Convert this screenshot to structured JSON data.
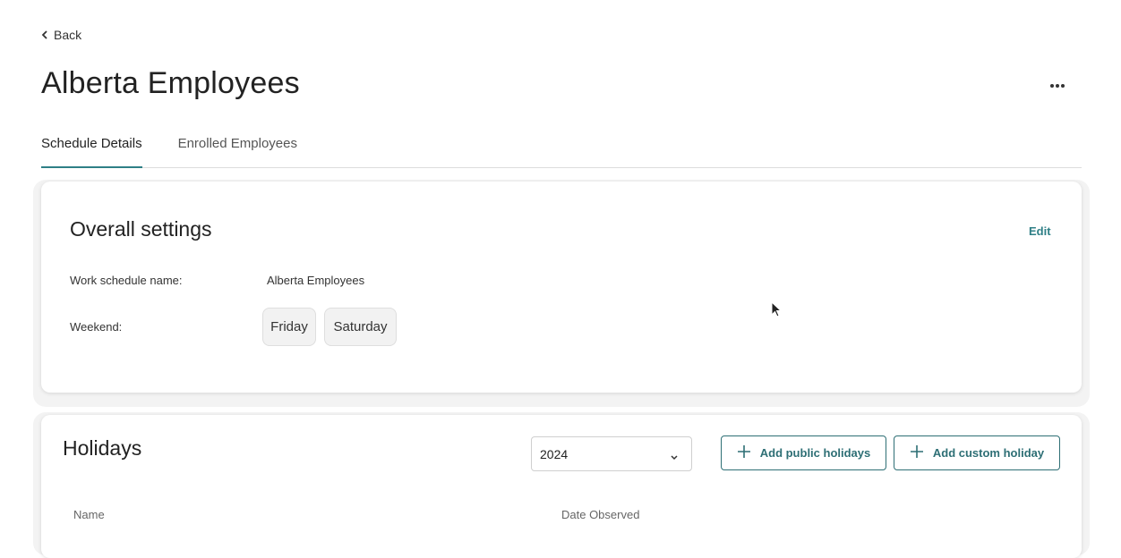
{
  "nav": {
    "back_label": "Back"
  },
  "page": {
    "title": "Alberta Employees"
  },
  "tabs": [
    {
      "label": "Schedule Details",
      "active": true
    },
    {
      "label": "Enrolled Employees",
      "active": false
    }
  ],
  "overall_settings": {
    "title": "Overall settings",
    "edit_label": "Edit",
    "work_schedule_name_label": "Work schedule name:",
    "work_schedule_name_value": "Alberta Employees",
    "weekend_label": "Weekend:",
    "weekend_days": [
      "Friday",
      "Saturday"
    ]
  },
  "holidays": {
    "title": "Holidays",
    "year_selected": "2024",
    "add_public_label": "Add public holidays",
    "add_custom_label": "Add custom holiday",
    "columns": [
      "Name",
      "Date Observed"
    ]
  },
  "colors": {
    "accent": "#2e7f86",
    "button_border": "#2e6f75"
  },
  "icons": {
    "back": "chevron-left-icon",
    "more": "ellipsis-icon",
    "select": "chevron-down-icon",
    "add": "plus-icon"
  }
}
